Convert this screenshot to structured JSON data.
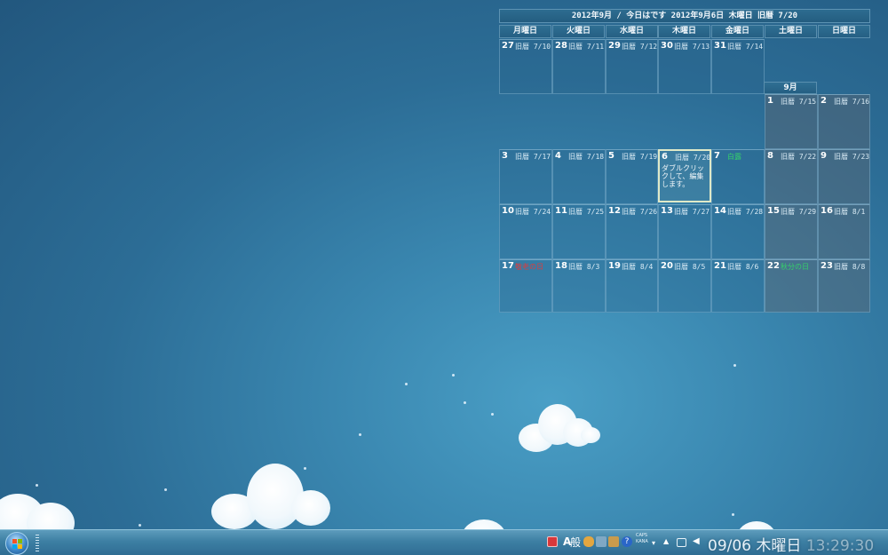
{
  "calendar": {
    "title": "2012年9月 / 今日はです 2012年9月6日 木曜日 旧暦 7/20",
    "weekdays": [
      "月曜日",
      "火曜日",
      "水曜日",
      "木曜日",
      "金曜日",
      "土曜日",
      "日曜日"
    ],
    "month_label": "9月",
    "rows": [
      [
        {
          "day": "27",
          "sub": "旧暦 7/10"
        },
        {
          "day": "28",
          "sub": "旧暦 7/11"
        },
        {
          "day": "29",
          "sub": "旧暦 7/12"
        },
        {
          "day": "30",
          "sub": "旧暦 7/13"
        },
        {
          "day": "31",
          "sub": "旧暦 7/14"
        },
        {
          "day": "1",
          "sub": "旧暦 7/15"
        },
        {
          "day": "2",
          "sub": "旧暦 7/16"
        }
      ],
      [
        {
          "day": "3",
          "sub": "旧暦 7/17"
        },
        {
          "day": "4",
          "sub": "旧暦 7/18"
        },
        {
          "day": "5",
          "sub": "旧暦 7/19"
        },
        {
          "day": "6",
          "sub": "旧暦 7/20",
          "note": "ダブルクリックして、編集します。"
        },
        {
          "day": "7",
          "sub": "白露",
          "style": "green"
        },
        {
          "day": "8",
          "sub": "旧暦 7/22"
        },
        {
          "day": "9",
          "sub": "旧暦 7/23"
        }
      ],
      [
        {
          "day": "10",
          "sub": "旧暦 7/24"
        },
        {
          "day": "11",
          "sub": "旧暦 7/25"
        },
        {
          "day": "12",
          "sub": "旧暦 7/26"
        },
        {
          "day": "13",
          "sub": "旧暦 7/27"
        },
        {
          "day": "14",
          "sub": "旧暦 7/28"
        },
        {
          "day": "15",
          "sub": "旧暦 7/29"
        },
        {
          "day": "16",
          "sub": "旧暦 8/1"
        }
      ],
      [
        {
          "day": "17",
          "sub": "敬老の日",
          "style": "red"
        },
        {
          "day": "18",
          "sub": "旧暦 8/3"
        },
        {
          "day": "19",
          "sub": "旧暦 8/4"
        },
        {
          "day": "20",
          "sub": "旧暦 8/5"
        },
        {
          "day": "21",
          "sub": "旧暦 8/6"
        },
        {
          "day": "22",
          "sub": "秋分の日",
          "style": "green"
        },
        {
          "day": "23",
          "sub": "旧暦 8/8"
        }
      ]
    ]
  },
  "taskbar": {
    "ime_mode": "A",
    "ime_kanji": "般",
    "caps_label": "CAPS",
    "kana_label": "KANA",
    "clock_date": "09/06",
    "clock_weekday": "木曜日",
    "clock_time": "13:29:30",
    "colors": {
      "accent": "#3d7fa3"
    },
    "icons": [
      "windows-start-icon",
      "red-app-icon",
      "ime-dictionary-icon",
      "tools-icon",
      "package-icon",
      "help-icon",
      "show-hidden-icons-icon",
      "network-icon",
      "volume-icon"
    ]
  }
}
